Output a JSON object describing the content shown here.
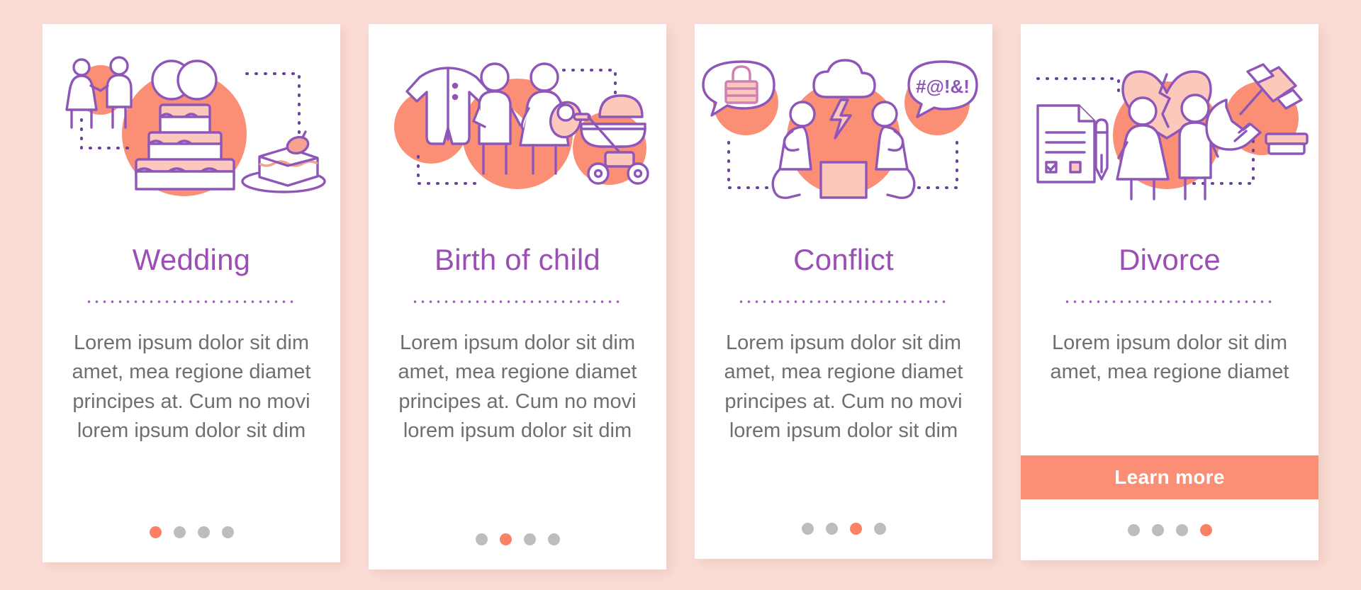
{
  "page": {
    "background_color": "#fbdcd5",
    "accent_color": "#fa8f75",
    "title_color": "#9b4fb5",
    "body_text_color": "#6f6f6f",
    "dot_inactive_color": "#bdbdbd",
    "dot_active_color": "#fa8163"
  },
  "cards": [
    {
      "id": "wedding",
      "title": "Wedding",
      "body": "Lorem ipsum dolor sit dim amet, mea regione diamet principes at. Cum no movi lorem ipsum dolor sit dim",
      "illustration": "wedding-illustration",
      "illustration_items": [
        "couple-icon",
        "wedding-rings-icon",
        "tiered-cake-icon",
        "cake-slice-icon"
      ],
      "has_cta": false,
      "cta_label": "",
      "dots": {
        "count": 4,
        "active_index": 0
      }
    },
    {
      "id": "birth-of-child",
      "title": "Birth of child",
      "body": "Lorem ipsum dolor sit dim amet, mea regione diamet principes at. Cum no movi lorem ipsum dolor sit dim",
      "illustration": "birth-of-child-illustration",
      "illustration_items": [
        "baby-onesie-icon",
        "parents-with-baby-icon",
        "baby-stroller-icon"
      ],
      "has_cta": false,
      "cta_label": "",
      "dots": {
        "count": 4,
        "active_index": 1
      }
    },
    {
      "id": "conflict",
      "title": "Conflict",
      "body": "Lorem ipsum dolor sit dim amet, mea regione diamet principes at. Cum no movi lorem ipsum dolor sit dim",
      "illustration": "conflict-illustration",
      "illustration_items": [
        "lock-speech-bubble-icon",
        "arguing-couple-icon",
        "swearing-speech-bubble-icon"
      ],
      "speech_bubble_text": "#@!&!",
      "has_cta": false,
      "cta_label": "",
      "dots": {
        "count": 4,
        "active_index": 2
      }
    },
    {
      "id": "divorce",
      "title": "Divorce",
      "body": "Lorem ipsum dolor sit dim amet, mea regione diamet",
      "illustration": "divorce-illustration",
      "illustration_items": [
        "document-and-pen-icon",
        "broken-heart-icon",
        "separating-couple-icon",
        "gavel-icon"
      ],
      "has_cta": true,
      "cta_label": "Learn more",
      "dots": {
        "count": 4,
        "active_index": 3
      }
    }
  ]
}
